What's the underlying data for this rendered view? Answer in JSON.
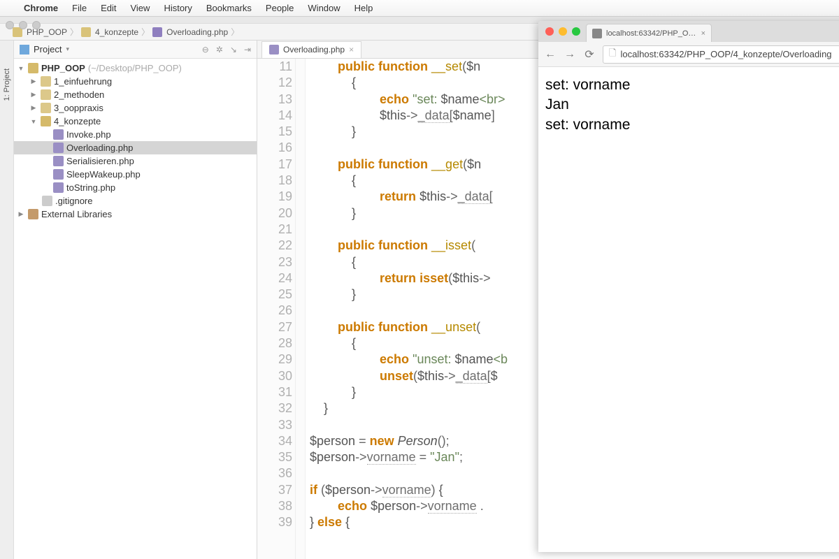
{
  "menubar": {
    "app": "Chrome",
    "items": [
      "File",
      "Edit",
      "View",
      "History",
      "Bookmarks",
      "People",
      "Window",
      "Help"
    ]
  },
  "breadcrumbs": [
    "PHP_OOP",
    "4_konzepte",
    "Overloading.php"
  ],
  "tooltab": "1: Project",
  "project": {
    "title": "Project",
    "root": {
      "name": "PHP_OOP",
      "path": "(~/Desktop/PHP_OOP)"
    },
    "folders": [
      "1_einfuehrung",
      "2_methoden",
      "3_ooppraxis",
      "4_konzepte"
    ],
    "files_in_konzepte": [
      "Invoke.php",
      "Overloading.php",
      "Serialisieren.php",
      "SleepWakeup.php",
      "toString.php"
    ],
    "gitignore": ".gitignore",
    "ext_lib": "External Libraries"
  },
  "editor": {
    "tab": "Overloading.php",
    "first_line": 11,
    "lines": [
      [
        [
          "kw",
          "public"
        ],
        [
          "sp",
          " "
        ],
        [
          "kw",
          "function"
        ],
        [
          "sp",
          " "
        ],
        [
          "mag",
          "__set"
        ],
        [
          "op",
          "("
        ],
        [
          "var",
          "$n"
        ]
      ],
      [
        [
          "brace",
          "{"
        ]
      ],
      [
        [
          "sp",
          "    "
        ],
        [
          "kw",
          "echo"
        ],
        [
          "sp",
          " "
        ],
        [
          "str",
          "\"set: "
        ],
        [
          "var",
          "$name"
        ],
        [
          "str",
          "<br>"
        ]
      ],
      [
        [
          "sp",
          "    "
        ],
        [
          "var",
          "$this"
        ],
        [
          "op",
          "->"
        ],
        [
          "prop",
          "_data"
        ],
        [
          "op",
          "["
        ],
        [
          "var",
          "$name"
        ],
        [
          "op",
          "]"
        ]
      ],
      [
        [
          "brace",
          "}"
        ]
      ],
      [],
      [
        [
          "kw",
          "public"
        ],
        [
          "sp",
          " "
        ],
        [
          "kw",
          "function"
        ],
        [
          "sp",
          " "
        ],
        [
          "mag",
          "__get"
        ],
        [
          "op",
          "("
        ],
        [
          "var",
          "$n"
        ]
      ],
      [
        [
          "brace",
          "{"
        ]
      ],
      [
        [
          "sp",
          "    "
        ],
        [
          "kw",
          "return"
        ],
        [
          "sp",
          " "
        ],
        [
          "var",
          "$this"
        ],
        [
          "op",
          "->"
        ],
        [
          "prop",
          "_data"
        ],
        [
          "op",
          "["
        ]
      ],
      [
        [
          "brace",
          "}"
        ]
      ],
      [],
      [
        [
          "kw",
          "public"
        ],
        [
          "sp",
          " "
        ],
        [
          "kw",
          "function"
        ],
        [
          "sp",
          " "
        ],
        [
          "mag",
          "__isset"
        ],
        [
          "op",
          "("
        ]
      ],
      [
        [
          "brace",
          "{"
        ]
      ],
      [
        [
          "sp",
          "    "
        ],
        [
          "kw",
          "return"
        ],
        [
          "sp",
          " "
        ],
        [
          "kw",
          "isset"
        ],
        [
          "op",
          "("
        ],
        [
          "var",
          "$this"
        ],
        [
          "op",
          "->"
        ]
      ],
      [
        [
          "brace",
          "}"
        ]
      ],
      [],
      [
        [
          "kw",
          "public"
        ],
        [
          "sp",
          " "
        ],
        [
          "kw",
          "function"
        ],
        [
          "sp",
          " "
        ],
        [
          "mag",
          "__unset"
        ],
        [
          "op",
          "("
        ]
      ],
      [
        [
          "brace",
          "{"
        ]
      ],
      [
        [
          "sp",
          "    "
        ],
        [
          "kw",
          "echo"
        ],
        [
          "sp",
          " "
        ],
        [
          "str",
          "\"unset: "
        ],
        [
          "var",
          "$name"
        ],
        [
          "str",
          "<b"
        ]
      ],
      [
        [
          "sp",
          "    "
        ],
        [
          "kw",
          "unset"
        ],
        [
          "op",
          "("
        ],
        [
          "var",
          "$this"
        ],
        [
          "op",
          "->"
        ],
        [
          "prop",
          "_data"
        ],
        [
          "op",
          "["
        ],
        [
          "var",
          "$"
        ]
      ],
      [
        [
          "brace",
          "}"
        ]
      ],
      [
        [
          "brace",
          "}"
        ]
      ],
      [],
      [
        [
          "var",
          "$person"
        ],
        [
          "sp",
          " "
        ],
        [
          "op",
          "="
        ],
        [
          "sp",
          " "
        ],
        [
          "kw",
          "new"
        ],
        [
          "sp",
          " "
        ],
        [
          "fn",
          "Person"
        ],
        [
          "op",
          "();"
        ]
      ],
      [
        [
          "var",
          "$person"
        ],
        [
          "op",
          "->"
        ],
        [
          "prop",
          "vorname"
        ],
        [
          "sp",
          " "
        ],
        [
          "op",
          "="
        ],
        [
          "sp",
          " "
        ],
        [
          "str",
          "\"Jan\""
        ],
        [
          "op",
          ";"
        ]
      ],
      [],
      [
        [
          "kw",
          "if"
        ],
        [
          "sp",
          " "
        ],
        [
          "op",
          "("
        ],
        [
          "var",
          "$person"
        ],
        [
          "op",
          "->"
        ],
        [
          "prop",
          "vorname"
        ],
        [
          "op",
          ")"
        ],
        [
          "sp",
          " "
        ],
        [
          "brace",
          "{"
        ]
      ],
      [
        [
          "sp",
          "    "
        ],
        [
          "kw",
          "echo"
        ],
        [
          "sp",
          " "
        ],
        [
          "var",
          "$person"
        ],
        [
          "op",
          "->"
        ],
        [
          "prop",
          "vorname"
        ],
        [
          "sp",
          " "
        ],
        [
          "op",
          "."
        ]
      ],
      [
        [
          "brace",
          "}"
        ],
        [
          "sp",
          " "
        ],
        [
          "kw",
          "else"
        ],
        [
          "sp",
          " "
        ],
        [
          "brace",
          "{"
        ]
      ]
    ],
    "indent_cols": [
      2,
      3,
      4,
      4,
      3,
      0,
      2,
      3,
      4,
      3,
      0,
      2,
      3,
      4,
      3,
      0,
      2,
      3,
      4,
      4,
      3,
      1,
      0,
      0,
      0,
      0,
      0,
      1,
      0
    ]
  },
  "browser": {
    "tab_title": "localhost:63342/PHP_OO…",
    "url": "localhost:63342/PHP_OOP/4_konzepte/Overloading",
    "body": [
      "set: vorname",
      "Jan",
      "set: vorname"
    ]
  }
}
